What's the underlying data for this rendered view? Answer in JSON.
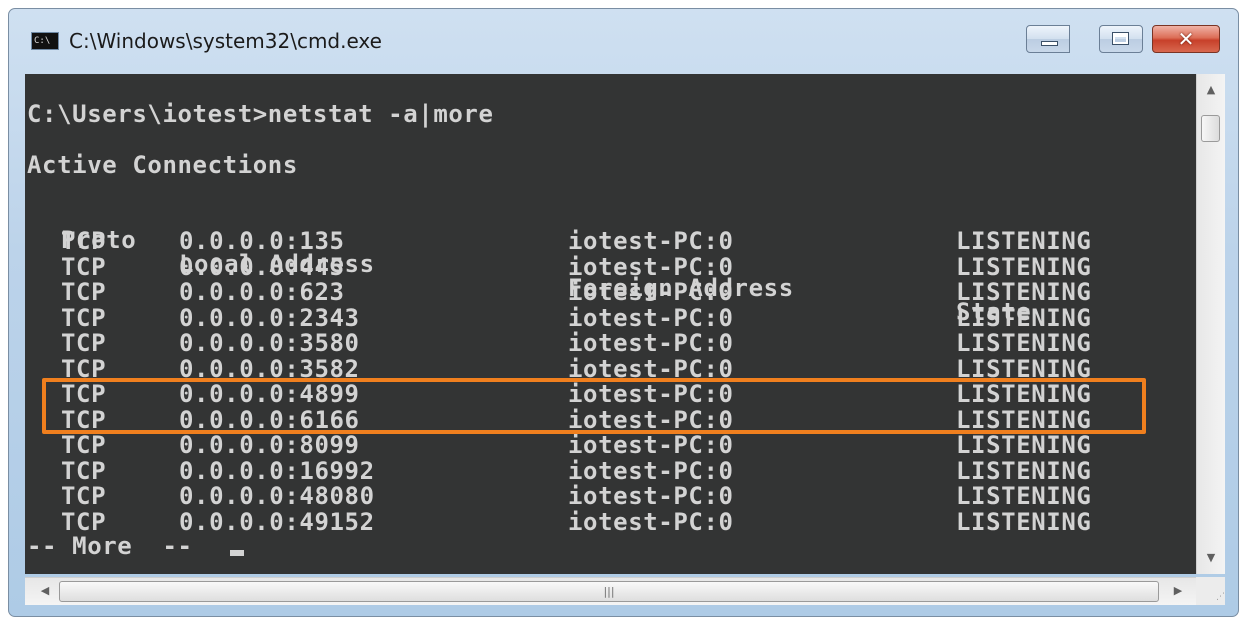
{
  "window": {
    "title": "C:\\Windows\\system32\\cmd.exe",
    "icon_label": "C:\\",
    "buttons": {
      "minimize": "minimize-icon",
      "maximize": "maximize-icon",
      "close": "close-icon",
      "close_glyph": "✕"
    }
  },
  "console": {
    "prompt_line": "C:\\Users\\iotest>netstat -a|more",
    "heading": "Active Connections",
    "columns": [
      "Proto",
      "Local Address",
      "Foreign Address",
      "State"
    ],
    "rows": [
      [
        "TCP",
        "0.0.0.0:135",
        "iotest-PC:0",
        "LISTENING"
      ],
      [
        "TCP",
        "0.0.0.0:445",
        "iotest-PC:0",
        "LISTENING"
      ],
      [
        "TCP",
        "0.0.0.0:623",
        "iotest-PC:0",
        "LISTENING"
      ],
      [
        "TCP",
        "0.0.0.0:2343",
        "iotest-PC:0",
        "LISTENING"
      ],
      [
        "TCP",
        "0.0.0.0:3580",
        "iotest-PC:0",
        "LISTENING"
      ],
      [
        "TCP",
        "0.0.0.0:3582",
        "iotest-PC:0",
        "LISTENING"
      ],
      [
        "TCP",
        "0.0.0.0:4899",
        "iotest-PC:0",
        "LISTENING"
      ],
      [
        "TCP",
        "0.0.0.0:6166",
        "iotest-PC:0",
        "LISTENING"
      ],
      [
        "TCP",
        "0.0.0.0:8099",
        "iotest-PC:0",
        "LISTENING"
      ],
      [
        "TCP",
        "0.0.0.0:16992",
        "iotest-PC:0",
        "LISTENING"
      ],
      [
        "TCP",
        "0.0.0.0:48080",
        "iotest-PC:0",
        "LISTENING"
      ],
      [
        "TCP",
        "0.0.0.0:49152",
        "iotest-PC:0",
        "LISTENING"
      ]
    ],
    "more_prompt": "-- More  --",
    "highlighted_row": 7
  },
  "scrollbars": {
    "vertical_up": "▲",
    "vertical_down": "▼",
    "horizontal_left": "◀",
    "horizontal_right": "▶",
    "horizontal_grip": "|||",
    "size_grip": "⋰"
  },
  "colors": {
    "console_bg": "#333434",
    "console_text": "#d3d3d3",
    "highlight": "#f07f1e"
  }
}
